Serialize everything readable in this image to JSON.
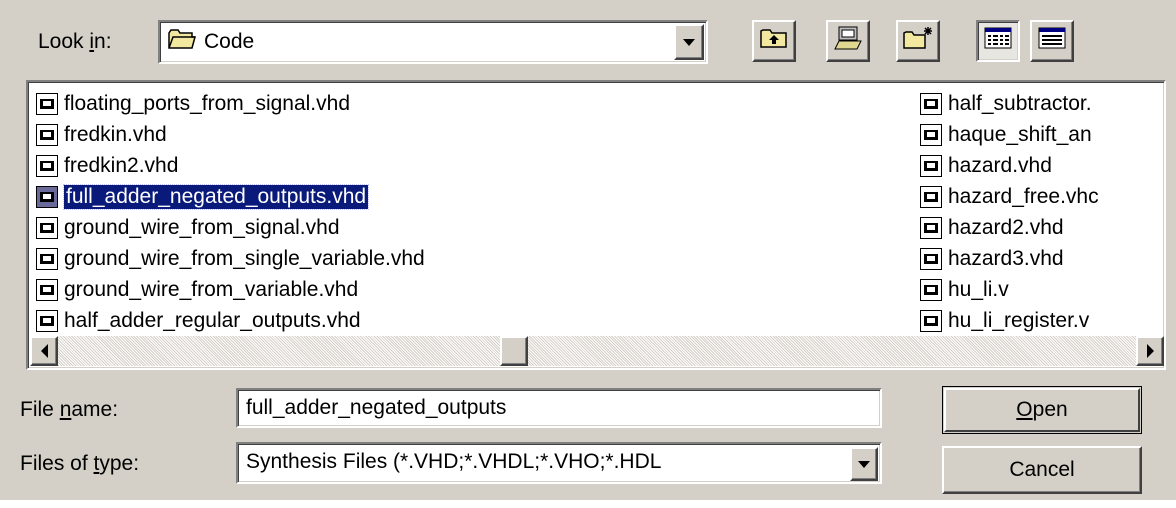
{
  "lookin": {
    "label_pre": "Look ",
    "label_key": "i",
    "label_post": "n:",
    "current": "Code"
  },
  "toolbar": {
    "icons": [
      "up-one-level-icon",
      "desktop-icon",
      "new-folder-icon",
      "list-view-icon",
      "details-view-icon"
    ]
  },
  "files": {
    "column1": [
      "floating_ports_from_signal.vhd",
      "fredkin.vhd",
      "fredkin2.vhd",
      "full_adder_negated_outputs.vhd",
      "ground_wire_from_signal.vhd",
      "ground_wire_from_single_variable.vhd",
      "ground_wire_from_variable.vhd",
      "half_adder_regular_outputs.vhd"
    ],
    "column2": [
      "half_subtractor.",
      "haque_shift_an",
      "hazard.vhd",
      "hazard_free.vhc",
      "hazard2.vhd",
      "hazard3.vhd",
      "hu_li.v",
      "hu_li_register.v"
    ],
    "selected": "full_adder_negated_outputs.vhd"
  },
  "filename": {
    "label_pre": "File ",
    "label_key": "n",
    "label_post": "ame:",
    "value": "full_adder_negated_outputs"
  },
  "filetype": {
    "label_pre": "Files of ",
    "label_key": "t",
    "label_post": "ype:",
    "value": "Synthesis Files (*.VHD;*.VHDL;*.VHO;*.HDL"
  },
  "buttons": {
    "open_key": "O",
    "open_rest": "pen",
    "cancel": "Cancel"
  },
  "colors": {
    "face": "#d4d0c8",
    "selection": "#0a1a7a"
  }
}
